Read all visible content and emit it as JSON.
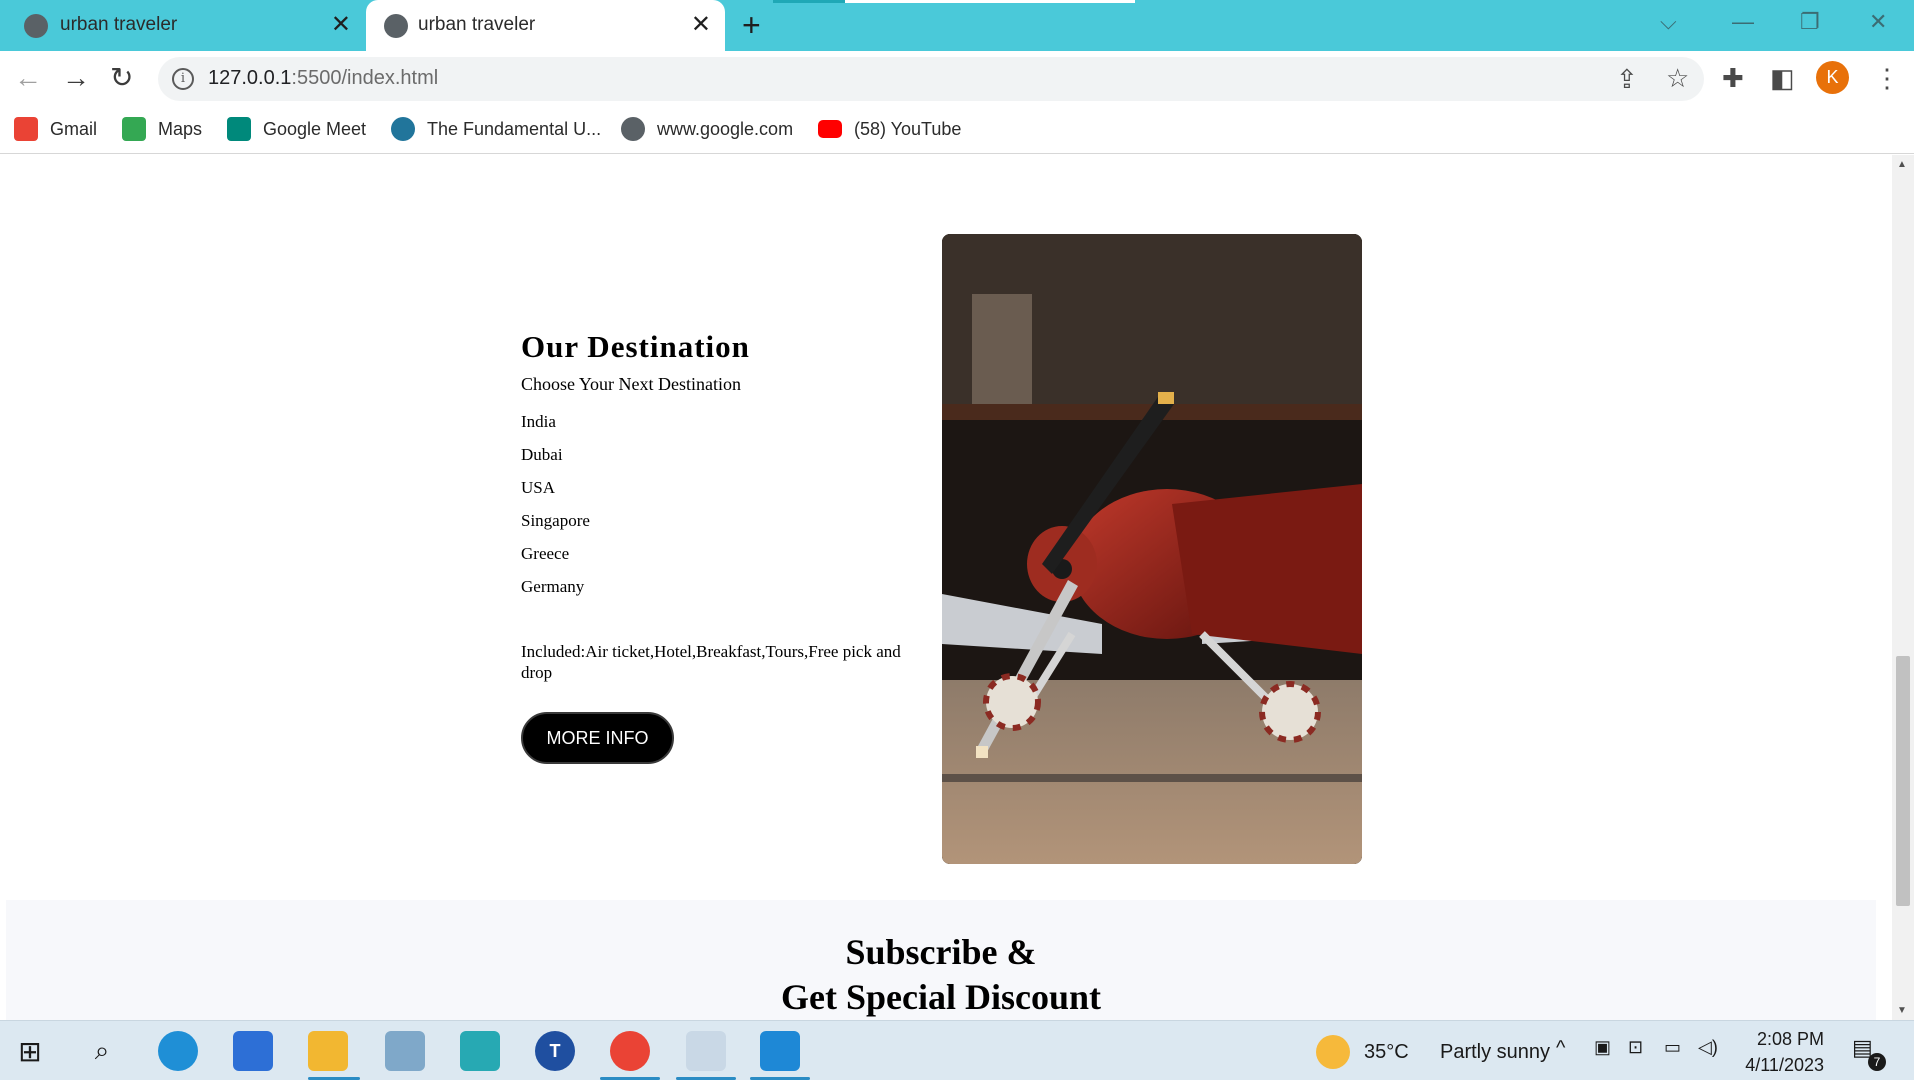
{
  "browser": {
    "tabs": [
      {
        "title": "urban traveler",
        "active": false
      },
      {
        "title": "urban traveler",
        "active": true
      }
    ],
    "new_tab_label": "+",
    "url_host": "127.0.0.1",
    "url_rest": ":5500/index.html",
    "profile_initial": "K",
    "bookmarks": [
      {
        "label": "Gmail",
        "icon": "gmail-icon",
        "color": "#ea4335"
      },
      {
        "label": "Maps",
        "icon": "maps-icon",
        "color": "#34a853"
      },
      {
        "label": "Google Meet",
        "icon": "meet-icon",
        "color": "#00897b"
      },
      {
        "label": "The Fundamental U...",
        "icon": "wordpress-icon",
        "color": "#21759b"
      },
      {
        "label": "www.google.com",
        "icon": "globe-icon",
        "color": "#5a6166"
      },
      {
        "label": "(58) YouTube",
        "icon": "youtube-icon",
        "color": "#ff0000"
      }
    ],
    "accent_color": "#4ac9d9"
  },
  "page": {
    "destination": {
      "heading": "Our Destination",
      "subheading": "Choose Your Next Destination",
      "places": [
        "India",
        "Dubai",
        "USA",
        "Singapore",
        "Greece",
        "Germany"
      ],
      "included": "Included:Air ticket,Hotel,Breakfast,Tours,Free pick and drop",
      "button_label": "MORE INFO"
    },
    "subscribe": {
      "line1": "Subscribe &",
      "line2": "Get Special Discount"
    }
  },
  "taskbar": {
    "weather_temp": "35°C",
    "weather_desc": "Partly sunny",
    "time": "2:08 PM",
    "date": "4/11/2023",
    "notification_count": "7"
  }
}
